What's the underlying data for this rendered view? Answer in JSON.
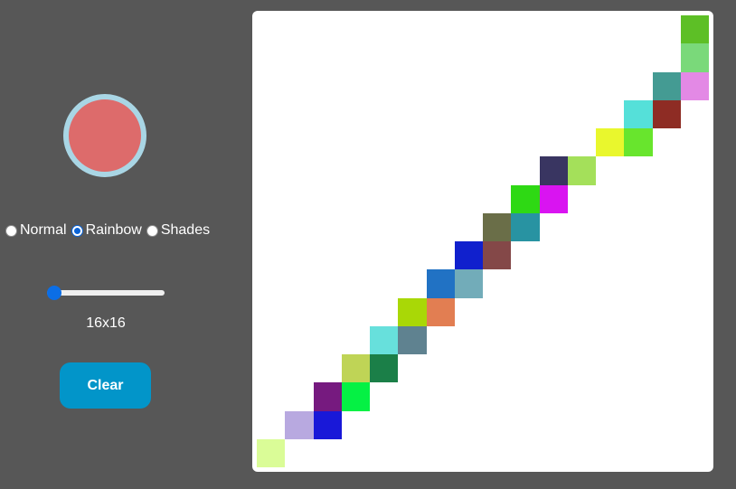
{
  "color_picker": {
    "current_color": "#dd6b6b",
    "ring_color": "#a9d6e5"
  },
  "modes": [
    {
      "id": "normal",
      "label": "Normal",
      "checked": false
    },
    {
      "id": "rainbow",
      "label": "Rainbow",
      "checked": true
    },
    {
      "id": "shades",
      "label": "Shades",
      "checked": false
    }
  ],
  "size_slider": {
    "value": 16,
    "min": 16,
    "max": 100,
    "label": "16x16"
  },
  "clear_button": {
    "label": "Clear",
    "color": "#0295c9"
  },
  "canvas": {
    "grid_size": 16,
    "background": "#ffffff",
    "painted_cells": [
      {
        "row": 0,
        "col": 15,
        "color": "#5dbf26"
      },
      {
        "row": 1,
        "col": 15,
        "color": "#7ad97a"
      },
      {
        "row": 2,
        "col": 14,
        "color": "#449b93"
      },
      {
        "row": 2,
        "col": 15,
        "color": "#e389e5"
      },
      {
        "row": 3,
        "col": 13,
        "color": "#55e0d9"
      },
      {
        "row": 3,
        "col": 14,
        "color": "#8e2c24"
      },
      {
        "row": 4,
        "col": 12,
        "color": "#e9f72d"
      },
      {
        "row": 4,
        "col": 13,
        "color": "#68e52d"
      },
      {
        "row": 5,
        "col": 10,
        "color": "#393561"
      },
      {
        "row": 5,
        "col": 11,
        "color": "#a4e05a"
      },
      {
        "row": 6,
        "col": 9,
        "color": "#2ed914"
      },
      {
        "row": 6,
        "col": 10,
        "color": "#d914f1"
      },
      {
        "row": 7,
        "col": 8,
        "color": "#6a6e48"
      },
      {
        "row": 7,
        "col": 9,
        "color": "#2893a2"
      },
      {
        "row": 8,
        "col": 7,
        "color": "#1020cd"
      },
      {
        "row": 8,
        "col": 8,
        "color": "#844848"
      },
      {
        "row": 9,
        "col": 6,
        "color": "#2172c4"
      },
      {
        "row": 9,
        "col": 7,
        "color": "#72acb9"
      },
      {
        "row": 10,
        "col": 5,
        "color": "#a9d806"
      },
      {
        "row": 10,
        "col": 6,
        "color": "#e27e52"
      },
      {
        "row": 11,
        "col": 4,
        "color": "#67e0dc"
      },
      {
        "row": 11,
        "col": 5,
        "color": "#5f8290"
      },
      {
        "row": 12,
        "col": 3,
        "color": "#bfd456"
      },
      {
        "row": 12,
        "col": 4,
        "color": "#1b7f48"
      },
      {
        "row": 13,
        "col": 2,
        "color": "#761a7f"
      },
      {
        "row": 13,
        "col": 3,
        "color": "#05f144"
      },
      {
        "row": 14,
        "col": 1,
        "color": "#b8a9e0"
      },
      {
        "row": 14,
        "col": 2,
        "color": "#1918d8"
      },
      {
        "row": 15,
        "col": 0,
        "color": "#dafc97"
      }
    ]
  }
}
